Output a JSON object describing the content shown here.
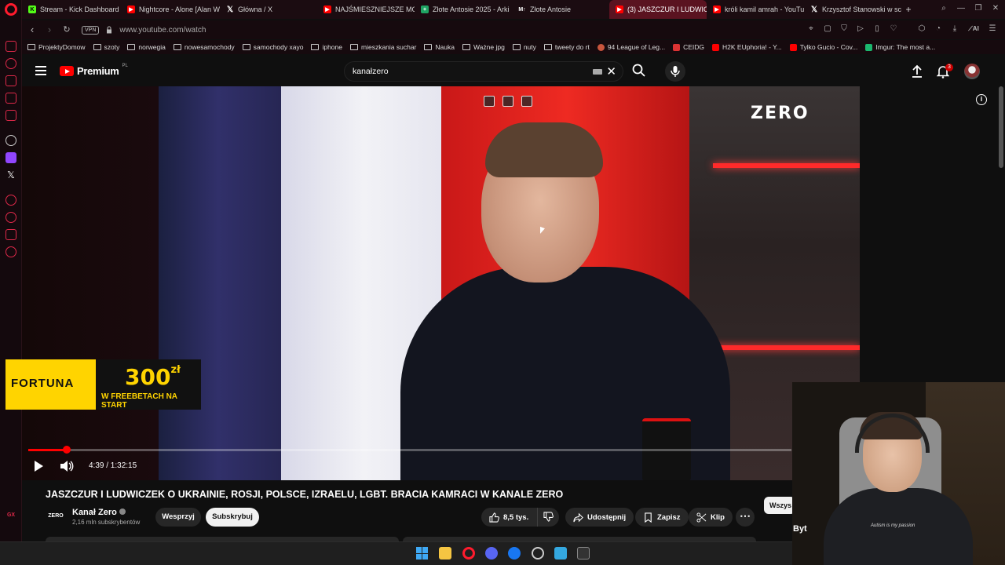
{
  "browser": {
    "tabs": [
      {
        "label": "Stream - Kick Dashboard",
        "favicon": "kick-icon",
        "active": false
      },
      {
        "label": "Nightcore - Alone [Alan W",
        "favicon": "youtube-icon",
        "active": false
      },
      {
        "label": "Główna / X",
        "favicon": "x-icon",
        "active": false
      },
      {
        "label": "NAJŚMIESZNIEJSZE MO",
        "favicon": "youtube-icon",
        "active": false
      },
      {
        "label": "Złote Antosie 2025 - Arki",
        "favicon": "sheets-icon",
        "active": false
      },
      {
        "label": "Złote Antosie",
        "favicon": "mt-icon",
        "active": false
      },
      {
        "label": "(3) JASZCZUR I LUDWICZ",
        "favicon": "youtube-icon",
        "active": true
      },
      {
        "label": "króli kamil amrah - YouTu",
        "favicon": "youtube-icon",
        "active": false
      },
      {
        "label": "Krzysztof Stanowski w sc",
        "favicon": "x-icon",
        "active": false
      }
    ],
    "vpn_label": "VPN",
    "url": "www.youtube.com/watch",
    "bookmarks": [
      {
        "label": "ProjektyDomow",
        "type": "folder"
      },
      {
        "label": "szoty",
        "type": "folder"
      },
      {
        "label": "norwegia",
        "type": "folder"
      },
      {
        "label": "nowesamochody",
        "type": "folder"
      },
      {
        "label": "samochody xayo",
        "type": "folder"
      },
      {
        "label": "iphone",
        "type": "folder"
      },
      {
        "label": "mieszkania suchar",
        "type": "folder"
      },
      {
        "label": "Nauka",
        "type": "folder"
      },
      {
        "label": "Ważne jpg",
        "type": "folder"
      },
      {
        "label": "nuty",
        "type": "folder"
      },
      {
        "label": "tweety do rt",
        "type": "folder"
      },
      {
        "label": "94 League of Leg...",
        "type": "link"
      },
      {
        "label": "CEIDG",
        "type": "link"
      },
      {
        "label": "H2K EUphoria! - Y...",
        "type": "link"
      },
      {
        "label": "Tylko Gucio - Cov...",
        "type": "link"
      },
      {
        "label": "Imgur: The most a...",
        "type": "link"
      }
    ]
  },
  "youtube": {
    "logo_text": "Premium",
    "logo_region": "PL",
    "search_value": "kanałzero",
    "notification_count": "3",
    "video": {
      "channel_watermark": "ZERO",
      "current_time": "4:39 / 1:32:15",
      "progress_fraction": 0.05
    },
    "ad": {
      "brand": "FORTUNA",
      "amount": "300",
      "currency": "zł",
      "subtitle": "W FREEBETACH NA START"
    },
    "title": "JASZCZUR I LUDWICZEK O UKRAINIE, ROSJI, POLSCE, IZRAELU, LGBT. BRACIA KAMRACI W KANALE ZERO",
    "channel": {
      "logo_text": "ZERO",
      "name": "Kanał Zero",
      "subscribers": "2,16 mln subskrybentów"
    },
    "buttons": {
      "support": "Wesprzyj",
      "subscribe": "Subskrybuj",
      "likes": "8,5 tys.",
      "share": "Udostępnij",
      "save": "Zapisz",
      "clip": "Klip",
      "filter_all": "Wszys"
    }
  },
  "webcam": {
    "shirt_text": "Autism is my passion",
    "overlay_text": "Byt"
  },
  "colors": {
    "accent_red": "#ff0000",
    "opera_red": "#ff1b2d",
    "bg": "#0f0f0f"
  }
}
